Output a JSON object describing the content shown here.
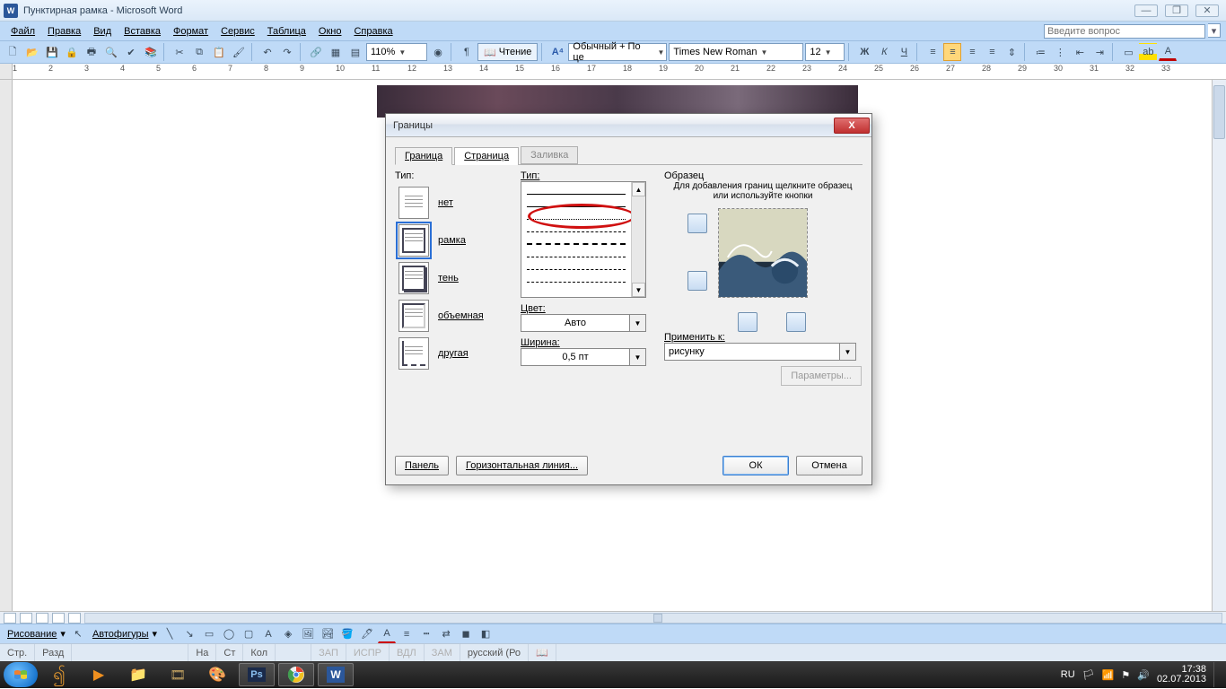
{
  "window": {
    "title": "Пунктирная рамка - Microsoft Word",
    "app_short": "W"
  },
  "menu": {
    "items": [
      "Файл",
      "Правка",
      "Вид",
      "Вставка",
      "Формат",
      "Сервис",
      "Таблица",
      "Окно",
      "Справка"
    ],
    "help_placeholder": "Введите вопрос"
  },
  "toolbar1": {
    "zoom": "110%",
    "read": "Чтение",
    "style": "Обычный + По це",
    "font": "Times New Roman",
    "size": "12"
  },
  "ruler": {
    "marks": [
      1,
      2,
      3,
      4,
      5,
      6,
      7,
      8,
      9,
      10,
      11,
      12,
      13,
      14,
      15,
      16,
      17,
      18,
      19,
      20,
      21,
      22,
      23,
      24,
      25,
      26,
      27,
      28,
      29,
      30,
      31,
      32,
      33
    ]
  },
  "dialog": {
    "title": "Границы",
    "tabs": {
      "border": "Граница",
      "page": "Страница",
      "fill": "Заливка"
    },
    "left": {
      "label": "Тип:",
      "items": [
        "нет",
        "рамка",
        "тень",
        "объемная",
        "другая"
      ]
    },
    "mid": {
      "type_label": "Тип:",
      "color_label": "Цвет:",
      "color_value": "Авто",
      "width_label": "Ширина:",
      "width_value": "0,5 пт"
    },
    "right": {
      "sample_label": "Образец",
      "hint": "Для добавления границ щелкните образец или используйте кнопки",
      "apply_label": "Применить к:",
      "apply_value": "рисунку",
      "params": "Параметры..."
    },
    "buttons": {
      "panel": "Панель",
      "hline": "Горизонтальная линия...",
      "ok": "ОК",
      "cancel": "Отмена"
    }
  },
  "statusbar": {
    "page": "Стр.",
    "sect": "Разд",
    "at": "На",
    "ln": "Ст",
    "col": "Кол",
    "rec": "ЗАП",
    "trk": "ИСПР",
    "ext": "ВДЛ",
    "ovr": "ЗАМ",
    "lang": "русский (Ро"
  },
  "drawbar": {
    "drawing": "Рисование",
    "autoshapes": "Автофигуры"
  },
  "taskbar": {
    "lang": "RU",
    "time": "17:38",
    "date": "02.07.2013"
  }
}
